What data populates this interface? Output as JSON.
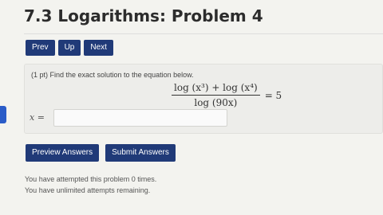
{
  "page": {
    "title": "7.3 Logarithms: Problem 4"
  },
  "nav": {
    "prev_label": "Prev",
    "up_label": "Up",
    "next_label": "Next"
  },
  "problem": {
    "prompt": "(1 pt) Find the exact solution to the equation below.",
    "equation": {
      "numerator": "log (x³) + log (x⁴)",
      "denominator": "log (90x)",
      "rhs": "= 5"
    },
    "answer_label": "x =",
    "answer_value": ""
  },
  "actions": {
    "preview_label": "Preview Answers",
    "submit_label": "Submit Answers"
  },
  "status": {
    "attempted": "You have attempted this problem 0 times.",
    "remaining": "You have unlimited attempts remaining."
  },
  "colors": {
    "button": "#203a78",
    "side_tab": "#2a5cc8",
    "background": "#f3f3ef"
  }
}
